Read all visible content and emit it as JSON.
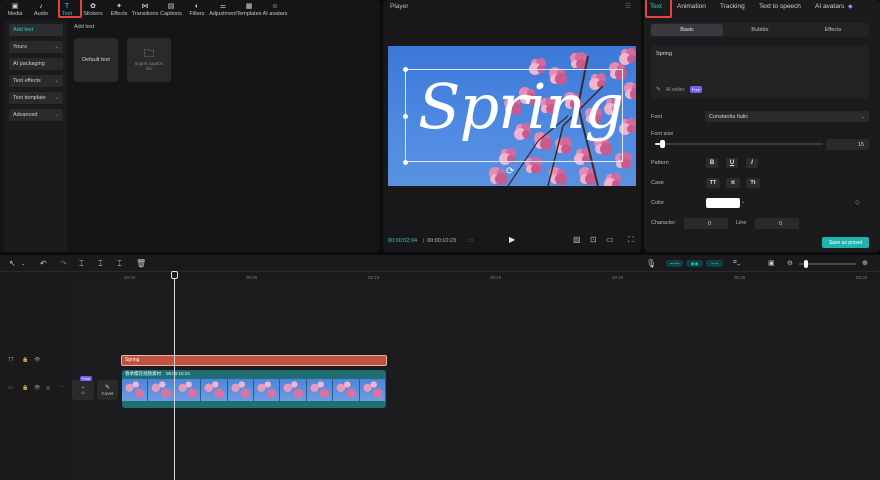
{
  "toolbar": {
    "tools": [
      {
        "label": "Media",
        "icon": "media-icon",
        "glyph": "▣"
      },
      {
        "label": "Audio",
        "icon": "audio-icon",
        "glyph": "♪"
      },
      {
        "label": "Text",
        "icon": "text-icon",
        "glyph": "T"
      },
      {
        "label": "Stickers",
        "icon": "stickers-icon",
        "glyph": "✿"
      },
      {
        "label": "Effects",
        "icon": "effects-icon",
        "glyph": "✦"
      },
      {
        "label": "Transitions",
        "icon": "transitions-icon",
        "glyph": "⋈"
      },
      {
        "label": "Captions",
        "icon": "captions-icon",
        "glyph": "▤"
      },
      {
        "label": "Filters",
        "icon": "filters-icon",
        "glyph": "◐"
      },
      {
        "label": "Adjustment",
        "icon": "adjustment-icon",
        "glyph": "⚌"
      },
      {
        "label": "Templates",
        "icon": "templates-icon",
        "glyph": "▦"
      },
      {
        "label": "AI avatars",
        "icon": "ai-avatars-icon",
        "glyph": "☺"
      }
    ],
    "active": "Text"
  },
  "text_sidebar": {
    "items": [
      {
        "label": "Add text",
        "selected": true,
        "chevron": false
      },
      {
        "label": "Yours",
        "chevron": true
      },
      {
        "label": "AI packaging",
        "chevron": false
      },
      {
        "label": "Text effects",
        "chevron": true
      },
      {
        "label": "Text template",
        "chevron": true
      },
      {
        "label": "Advanced",
        "chevron": true
      }
    ],
    "section_title": "Add text",
    "default_card": "Default text",
    "import_card": "Import caption file"
  },
  "player": {
    "title": "Player",
    "preview_text": "Spring",
    "current_time": "00:00:02:04",
    "total_time": "00:00:10:23"
  },
  "props": {
    "tabs": [
      "Text",
      "Animation",
      "Tracking",
      "Text to speech",
      "AI avatars"
    ],
    "active_tab": "Text",
    "subtabs": [
      "Basic",
      "Bubble",
      "Effects"
    ],
    "active_subtab": "Basic",
    "text_value": "Spring",
    "ai_writer": "AI writer",
    "ai_badge": "Free",
    "font_label": "Font",
    "font_value": "Constantia Italic",
    "size_label": "Font size",
    "size_value": "15",
    "size_fraction": 0.04,
    "pattern_label": "Pattern",
    "pattern_buttons": [
      "B",
      "U",
      "I"
    ],
    "case_label": "Case",
    "case_buttons": [
      "TT",
      "tt",
      "Tt"
    ],
    "color_label": "Color",
    "color_value": "#ffffff",
    "character_label": "Character",
    "character_value": "0",
    "line_label": "Line",
    "line_value": "0",
    "save_preset": "Save as preset"
  },
  "timeline": {
    "ruler": [
      "00:00",
      "00:05",
      "00:10",
      "00:15",
      "00:20",
      "00:25",
      "00:30"
    ],
    "text_clip": "Spring",
    "video_clip_name": "春季樱花视频素材",
    "video_clip_duration": "00:00:10:23",
    "cover_label": "Cover",
    "free_badge": "Free",
    "ai_label": "AI"
  },
  "colors": {
    "accent": "#22d3c5",
    "highlight": "#e0463e",
    "text_clip": "#c0513f",
    "video_clip": "#1f6e73",
    "sky": "#3f7fe0"
  }
}
